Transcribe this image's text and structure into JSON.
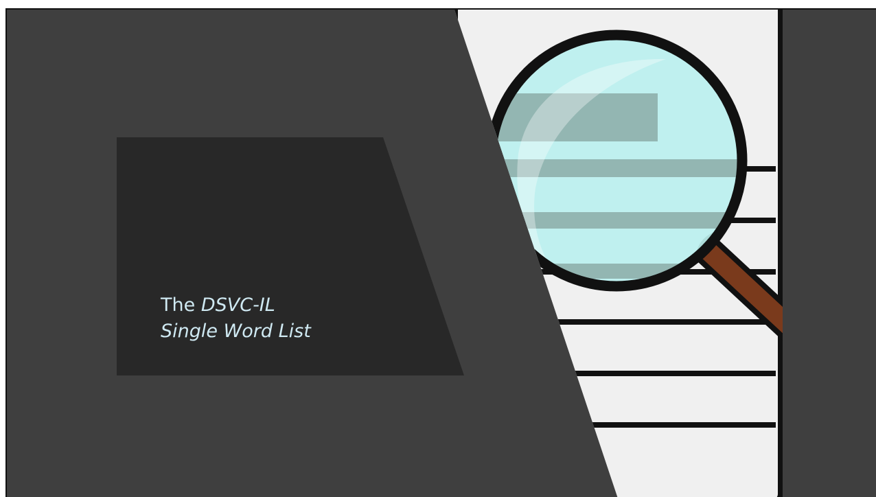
{
  "slide": {
    "title_prefix": "The ",
    "title_line1_italic": "DSVC-IL",
    "title_line2_italic": "Single Word List"
  },
  "illustration": {
    "icon": "magnifying-glass-over-document-icon",
    "colors": {
      "background": "#3f3f3f",
      "title_panel": "#282828",
      "paper": "#f0f0f0",
      "lines": "#111111",
      "lens": "#bff0ef",
      "handle": "#7a3a1c",
      "title_text": "#cfe9f2"
    }
  }
}
